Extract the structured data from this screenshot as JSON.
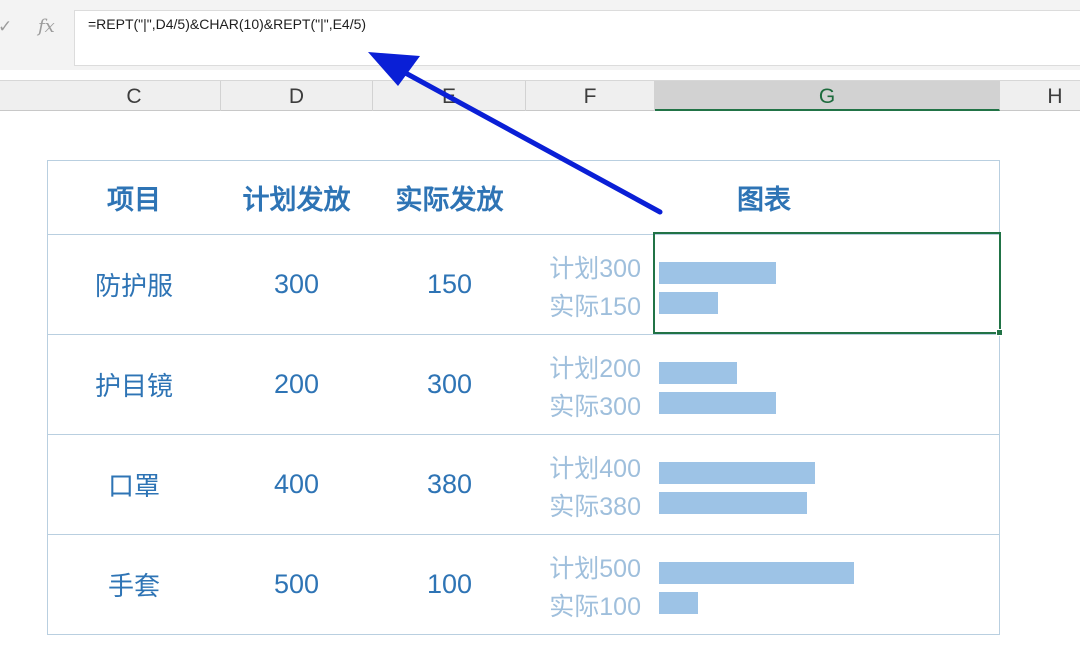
{
  "formula_bar": {
    "check_icon": "✓",
    "fx_icon": "fx",
    "formula": "=REPT(\"|\",D4/5)&CHAR(10)&REPT(\"|\",E4/5)"
  },
  "columns": [
    {
      "label": "C"
    },
    {
      "label": "D"
    },
    {
      "label": "E"
    },
    {
      "label": "F"
    },
    {
      "label": "G",
      "selected": true
    },
    {
      "label": "H"
    }
  ],
  "table": {
    "headers": {
      "item": "项目",
      "plan": "计划发放",
      "actual": "实际发放",
      "chart": "图表"
    },
    "rows": [
      {
        "item": "防护服",
        "plan": 300,
        "actual": 150,
        "plan_prefix": "计划",
        "plan_label": "300",
        "actual_prefix": "实际",
        "actual_label": "150"
      },
      {
        "item": "护目镜",
        "plan": 200,
        "actual": 300,
        "plan_prefix": "计划",
        "plan_label": "200",
        "actual_prefix": "实际",
        "actual_label": "300"
      },
      {
        "item": "口罩",
        "plan": 400,
        "actual": 380,
        "plan_prefix": "计划",
        "plan_label": "400",
        "actual_prefix": "实际",
        "actual_label": "380"
      },
      {
        "item": "手套",
        "plan": 500,
        "actual": 100,
        "plan_prefix": "计划",
        "plan_label": "500",
        "actual_prefix": "实际",
        "actual_label": "100"
      }
    ]
  },
  "colors": {
    "text": "#2e74b5",
    "label": "#9fbfdc",
    "bar": "#9dc3e6",
    "selection": "#217346",
    "arrow": "#0a1fd6"
  }
}
